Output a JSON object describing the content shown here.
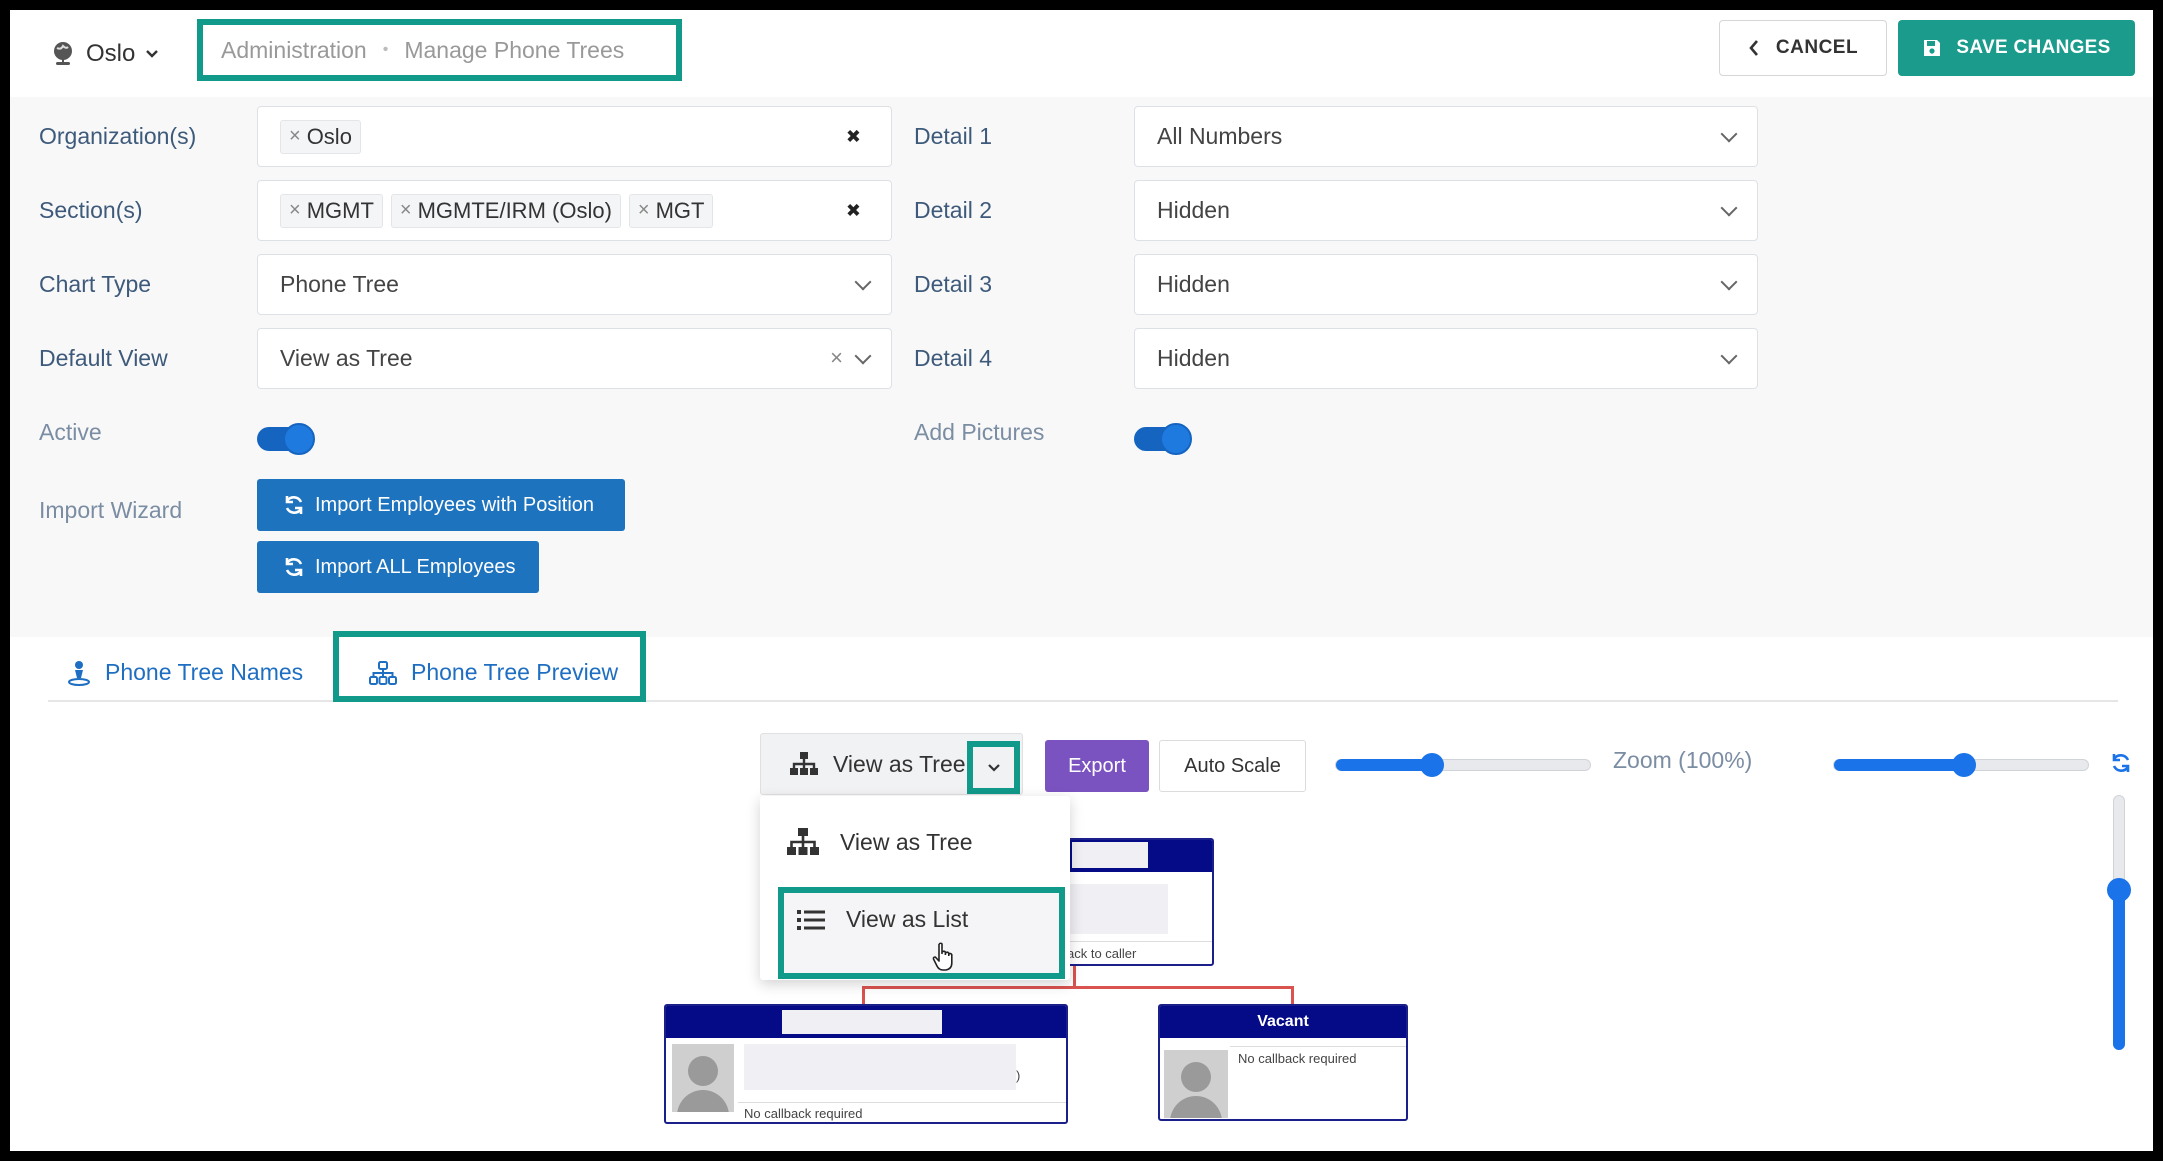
{
  "header": {
    "org_name": "Oslo",
    "breadcrumb": [
      "Administration",
      "Manage Phone Trees"
    ],
    "cancel_label": "CANCEL",
    "save_label": "SAVE CHANGES"
  },
  "form": {
    "organizations": {
      "label": "Organization(s)",
      "tags": [
        "Oslo"
      ]
    },
    "sections": {
      "label": "Section(s)",
      "tags": [
        "MGMT",
        "MGMTE/IRM (Oslo)",
        "MGT"
      ]
    },
    "chart_type": {
      "label": "Chart Type",
      "value": "Phone Tree"
    },
    "default_view": {
      "label": "Default View",
      "value": "View as Tree"
    },
    "active": {
      "label": "Active",
      "on": true
    },
    "import_wizard": {
      "label": "Import Wizard",
      "buttons": [
        "Import Employees with Position",
        "Import ALL Employees"
      ]
    },
    "details": [
      {
        "label": "Detail 1",
        "value": "All Numbers"
      },
      {
        "label": "Detail 2",
        "value": "Hidden"
      },
      {
        "label": "Detail 3",
        "value": "Hidden"
      },
      {
        "label": "Detail 4",
        "value": "Hidden"
      }
    ],
    "add_pictures": {
      "label": "Add Pictures",
      "on": true
    }
  },
  "tabs": [
    {
      "label": "Phone Tree Names",
      "active": false
    },
    {
      "label": "Phone Tree Preview",
      "active": true
    }
  ],
  "preview": {
    "view_select": "View as Tree",
    "export_label": "Export",
    "auto_scale_label": "Auto Scale",
    "zoom_label": "Zoom (100%)",
    "dropdown_options": [
      "View as Tree",
      "View as List"
    ],
    "cards": {
      "top_partial_text": "ack to caller",
      "left_callback": "No callback required",
      "left_partial_char": ")",
      "right_title": "Vacant",
      "right_callback": "No callback required"
    }
  },
  "colors": {
    "teal_highlight": "#119a8a",
    "save_button": "#1a9b8c",
    "primary_blue": "#1e73be",
    "export_purple": "#7b53c1",
    "card_header": "#050a87",
    "connector": "#d9534f"
  }
}
